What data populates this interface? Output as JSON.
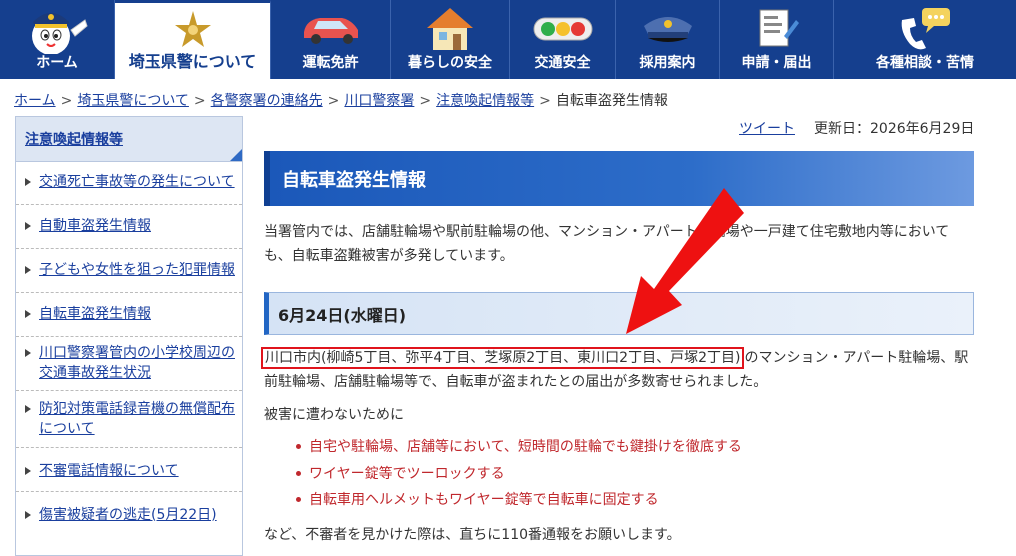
{
  "nav": {
    "items": [
      {
        "label": "ホーム",
        "icon": "mascot-icon"
      },
      {
        "label": "埼玉県警について",
        "icon": "police-emblem-icon",
        "active": true
      },
      {
        "label": "運転免許",
        "icon": "car-icon"
      },
      {
        "label": "暮らしの安全",
        "icon": "house-icon"
      },
      {
        "label": "交通安全",
        "icon": "traffic-light-icon"
      },
      {
        "label": "採用案内",
        "icon": "police-cap-icon"
      },
      {
        "label": "申請・届出",
        "icon": "form-document-icon"
      },
      {
        "label": "各種相談・苦情",
        "icon": "phone-chat-icon"
      }
    ]
  },
  "breadcrumb": {
    "links": [
      "ホーム",
      "埼玉県警について",
      "各警察署の連絡先",
      "川口警察署",
      "注意喚起情報等"
    ],
    "current": "自転車盗発生情報",
    "separator": ">"
  },
  "sidebar": {
    "heading": "注意喚起情報等",
    "items": [
      "交通死亡事故等の発生について",
      "自動車盗発生情報",
      "子どもや女性を狙った犯罪情報",
      "自転車盗発生情報",
      "川口警察署管内の小学校周辺の交通事故発生状況",
      "防犯対策電話録音機の無償配布について",
      "不審電話情報について",
      "傷害被疑者の逃走(5月22日)"
    ]
  },
  "meta": {
    "tweet": "ツイート",
    "updated": "更新日：2026年6月29日"
  },
  "page": {
    "title": "自転車盗発生情報",
    "intro": "当署管内では、店舗駐輪場や駅前駐輪場の他、マンション・アパート駐輪場や一戸建て住宅敷地内等においても、自転車盗難被害が多発しています。",
    "section_date": "6月24日(水曜日)",
    "highlight": "川口市内(柳崎5丁目、弥平4丁目、芝塚原2丁目、東川口2丁目、戸塚2丁目)",
    "para_rest": "のマンション・アパート駐輪場、駅前駐輪場、店舗駐輪場等で、自転車が盗まれたとの届出が多数寄せられました。",
    "prevent_heading": "被害に遭わないために",
    "tips": [
      "自宅や駐輪場、店舗等において、短時間の駐輪でも鍵掛けを徹底する",
      "ワイヤー錠等でツーロックする",
      "自転車用ヘルメットもワイヤー錠等で自転車に固定する"
    ],
    "closing": "など、不審者を見かけた際は、直ちに110番通報をお願いします。"
  },
  "colors": {
    "nav_bg": "#153f8e",
    "link": "#1a3f9e",
    "tip_text": "#c0282d",
    "annotation": "#e0141c"
  }
}
